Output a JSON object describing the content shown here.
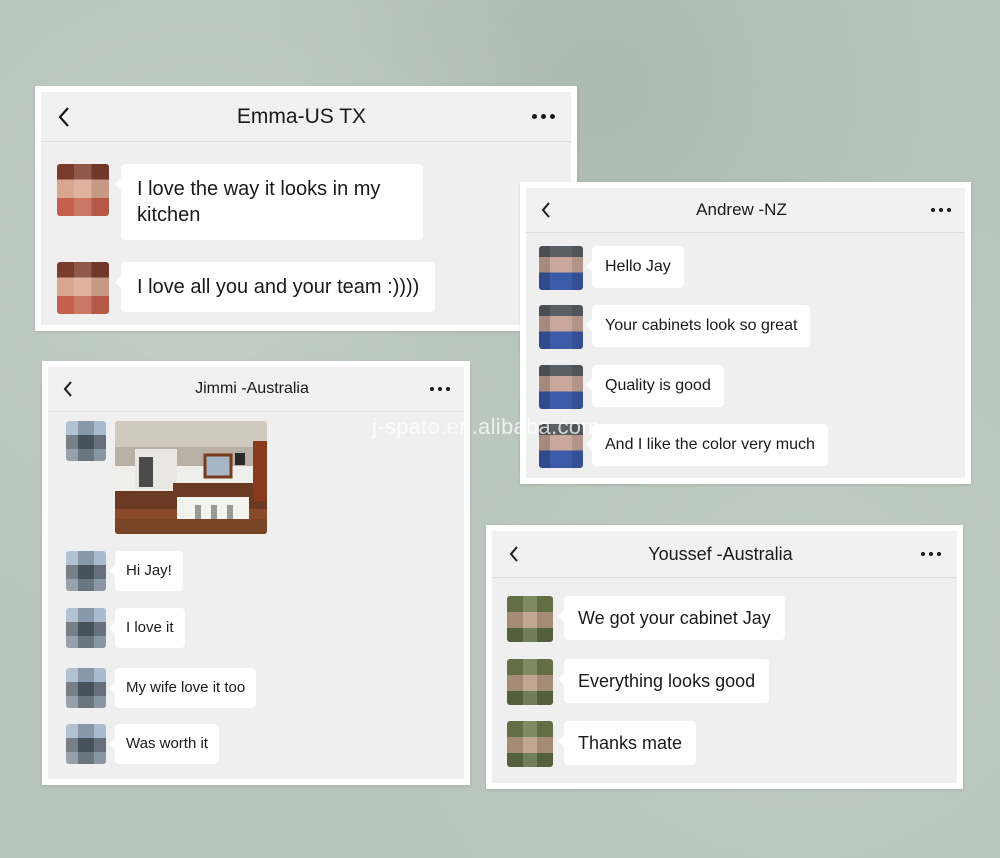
{
  "watermark": "j-spato.en.alibaba.com",
  "chats": {
    "emma": {
      "title": "Emma-US TX",
      "messages": [
        "I love the way it looks in my kitchen",
        "I love all you and your team :))))"
      ]
    },
    "andrew": {
      "title": "Andrew -NZ",
      "messages": [
        "Hello Jay",
        "Your cabinets look so great",
        "Quality is good",
        "And I like the color very much"
      ]
    },
    "jimmi": {
      "title": "Jimmi -Australia",
      "messages": [
        "Hi Jay!",
        "I love it",
        "My wife love it too",
        "Was worth it"
      ]
    },
    "youssef": {
      "title": "Youssef -Australia",
      "messages": [
        "We got your cabinet Jay",
        "Everything looks good",
        "Thanks mate"
      ]
    }
  },
  "icons": {
    "back": "chevron-left-icon",
    "more": "more-horizontal-icon"
  },
  "colors": {
    "background": "#b6c4bb",
    "chat_background": "#efefef",
    "bubble": "#ffffff",
    "text": "#1a1a1a"
  }
}
